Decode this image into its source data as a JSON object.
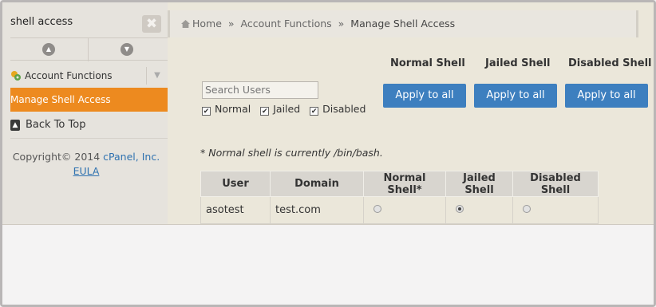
{
  "sidebar": {
    "search_value": "shell access",
    "clear_label": "✖",
    "account_functions": "Account Functions",
    "active_item": "Manage Shell Access",
    "back_to_top": "Back To Top",
    "copyright_prefix": "Copyright© 2014",
    "copyright_link": "cPanel, Inc.",
    "eula": "EULA"
  },
  "breadcrumb": {
    "home": "Home",
    "separator": "»",
    "section": "Account Functions",
    "current": "Manage Shell Access"
  },
  "main": {
    "search_placeholder": "Search Users",
    "filters": [
      "Normal",
      "Jailed",
      "Disabled"
    ],
    "columns": [
      {
        "title": "Normal Shell",
        "button": "Apply to all"
      },
      {
        "title": "Jailed Shell",
        "button": "Apply to all"
      },
      {
        "title": "Disabled Shell",
        "button": "Apply to all"
      }
    ],
    "note": "* Normal shell is currently /bin/bash."
  },
  "table": {
    "headers": [
      "User",
      "Domain",
      "Normal Shell*",
      "Jailed Shell",
      "Disabled Shell"
    ],
    "rows": [
      {
        "user": "asotest",
        "domain": "test.com",
        "selected": "Jailed Shell"
      }
    ]
  },
  "colors": {
    "accent": "#ed8a1f",
    "button": "#3d7fbf",
    "link": "#2f72b0"
  }
}
